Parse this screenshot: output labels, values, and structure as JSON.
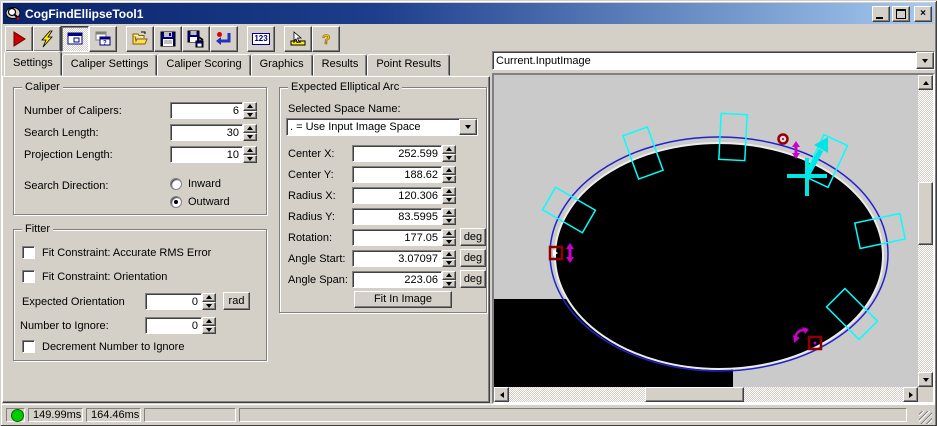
{
  "window": {
    "title": "CogFindEllipseTool1"
  },
  "toolbar": {
    "calc_label": "123",
    "buttons": [
      "run-icon",
      "trigger-lightning-icon",
      "result-window-icon",
      "float-window-icon",
      "open-folder-icon",
      "save-icon",
      "save-as-icon",
      "reset-icon",
      "numeric-123-icon",
      "position-ruler-icon",
      "help-icon"
    ]
  },
  "tabs": {
    "items": [
      "Settings",
      "Caliper Settings",
      "Caliper Scoring",
      "Graphics",
      "Results",
      "Point Results"
    ],
    "active": "Settings"
  },
  "caliper": {
    "title": "Caliper",
    "fields": [
      {
        "label": "Number of Calipers:",
        "value": "6"
      },
      {
        "label": "Search Length:",
        "value": "30"
      },
      {
        "label": "Projection Length:",
        "value": "10"
      }
    ],
    "direction_label": "Search Direction:",
    "options": [
      {
        "label": "Inward",
        "selected": false
      },
      {
        "label": "Outward",
        "selected": true
      }
    ]
  },
  "fitter": {
    "title": "Fitter",
    "checkboxes": [
      {
        "label": "Fit Constraint: Accurate RMS Error",
        "checked": false
      },
      {
        "label": "Fit Constraint: Orientation",
        "checked": false
      }
    ],
    "expected_orientation": {
      "label": "Expected Orientation",
      "value": "0",
      "unit": "rad"
    },
    "number_to_ignore": {
      "label": "Number to Ignore:",
      "value": "0"
    },
    "decrement": {
      "label": "Decrement Number to Ignore",
      "checked": false
    }
  },
  "arc": {
    "title": "Expected Elliptical Arc",
    "space_label": "Selected Space Name:",
    "space_value": ". = Use Input Image Space",
    "fields": [
      {
        "label": "Center X:",
        "value": "252.599"
      },
      {
        "label": "Center Y:",
        "value": "188.62"
      },
      {
        "label": "Radius X:",
        "value": "120.306"
      },
      {
        "label": "Radius Y:",
        "value": "83.5995"
      },
      {
        "label": "Rotation:",
        "value": "177.05",
        "unit": "deg"
      },
      {
        "label": "Angle Start:",
        "value": "3.07097",
        "unit": "deg"
      },
      {
        "label": "Angle Span:",
        "value": "223.06",
        "unit": "deg"
      }
    ],
    "fit_button": "Fit In Image"
  },
  "image_panel": {
    "source": "Current.InputImage"
  },
  "status": {
    "t1": "149.99ms",
    "t2": "164.46ms"
  },
  "colors": {
    "overlay_cyan": "#00ffff",
    "overlay_blue": "#2222cc",
    "handle_dark_red": "#900000",
    "handle_magenta": "#cc00cc",
    "led_green": "#00cc00",
    "titlebar_left": "#0a246a",
    "titlebar_right": "#a6caf0"
  }
}
